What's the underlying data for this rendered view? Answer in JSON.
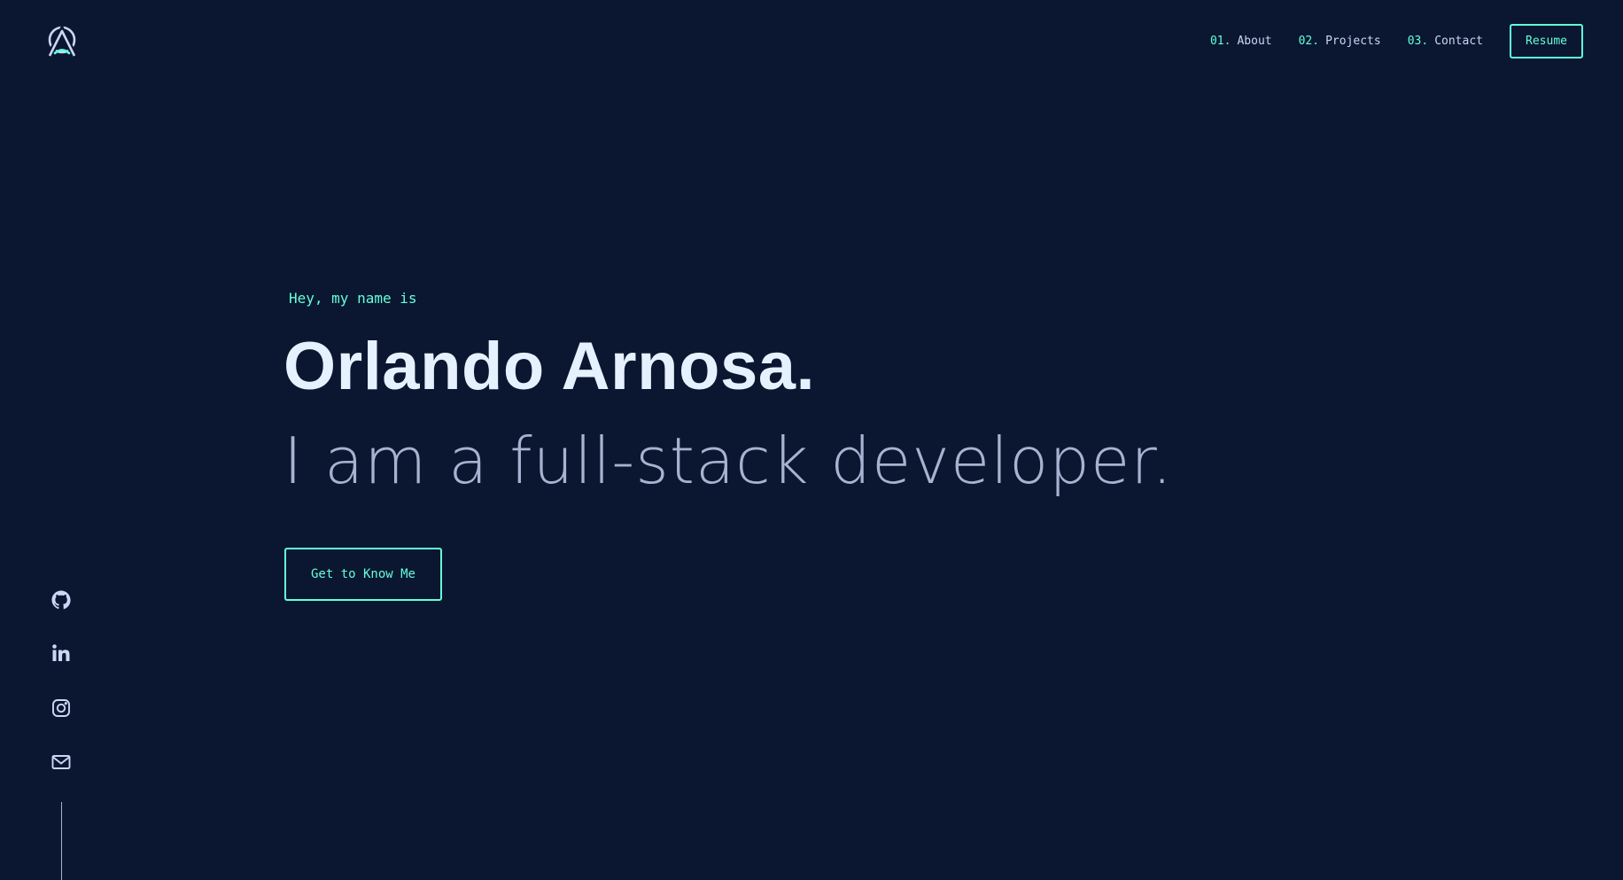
{
  "header": {
    "logo_icon": "logo-icon",
    "nav": [
      {
        "number": "01.",
        "label": "About"
      },
      {
        "number": "02.",
        "label": "Projects"
      },
      {
        "number": "03.",
        "label": "Contact"
      }
    ],
    "resume_label": "Resume"
  },
  "hero": {
    "greeting": "Hey, my name is",
    "name": "Orlando Arnosa.",
    "tagline": "I am a full-stack developer.",
    "cta_label": "Get to Know Me"
  },
  "social": {
    "icons": [
      "github-icon",
      "linkedin-icon",
      "instagram-icon",
      "email-icon"
    ]
  },
  "colors": {
    "background": "#0b1730",
    "accent": "#64ffda",
    "heading": "#e6f1ff",
    "text": "#ccd6f6",
    "muted": "#a8b2d1"
  }
}
